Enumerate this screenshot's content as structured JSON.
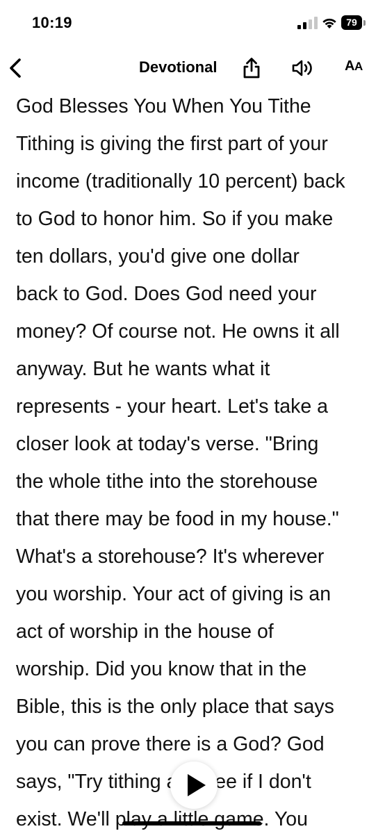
{
  "status_bar": {
    "time": "10:19",
    "battery": "79",
    "signal_icon": "cellular-signal-icon",
    "wifi_icon": "wifi-icon",
    "battery_icon": "battery-icon"
  },
  "nav": {
    "back_icon": "chevron-left-icon",
    "title": "Devotional",
    "share_icon": "share-icon",
    "audio_icon": "speaker-icon",
    "text_size_label_large": "A",
    "text_size_label_small": "A"
  },
  "content": {
    "lines": [
      "God Blesses You When You Tithe",
      "Tithing is giving the first part of your",
      "income (traditionally 10 percent) back",
      "to God to honor him. So if you make",
      "ten dollars, you'd give one dollar",
      "back to God. Does God need your",
      "money? Of course not. He owns it all",
      "anyway. But he wants what it",
      "represents - your heart. Let's take a",
      "closer look at today's verse. \"Bring",
      "the whole tithe into the storehouse",
      "that there may be food in my house.\"",
      "What's a storehouse? It's wherever",
      "you worship. Your act of giving is an",
      "act of worship in the house of",
      "worship. Did you know that in the",
      "Bible, this is the only place that says",
      "you can prove there is a God? God",
      "says, \"Try tithing and see if I don't",
      "exist. We'll play a little game. You"
    ]
  },
  "player": {
    "play_icon": "play-icon"
  },
  "colors": {
    "background": "#ffffff",
    "text": "#111111",
    "accent": "#000000"
  }
}
